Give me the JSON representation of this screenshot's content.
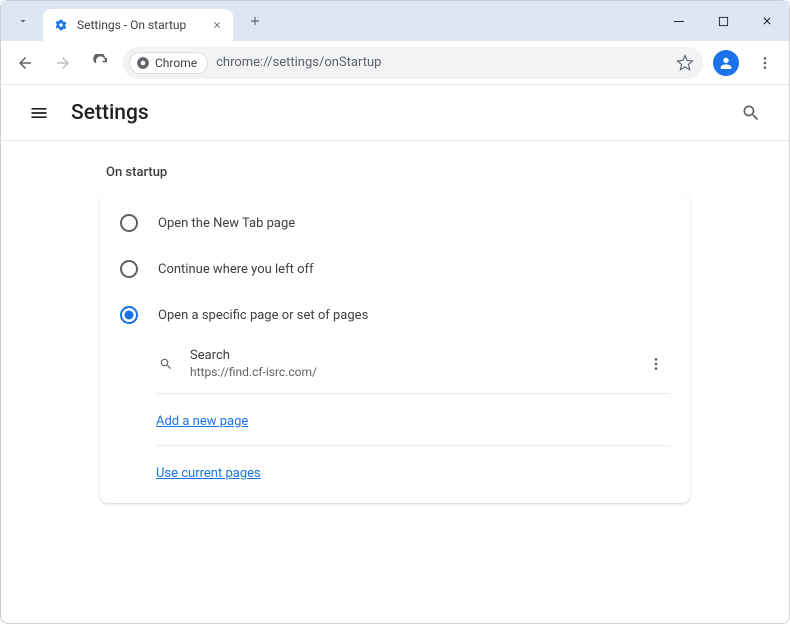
{
  "window": {
    "tab_title": "Settings - On startup"
  },
  "toolbar": {
    "chip_label": "Chrome",
    "url": "chrome://settings/onStartup"
  },
  "header": {
    "title": "Settings"
  },
  "section": {
    "title": "On startup",
    "options": [
      {
        "label": "Open the New Tab page",
        "selected": false
      },
      {
        "label": "Continue where you left off",
        "selected": false
      },
      {
        "label": "Open a specific page or set of pages",
        "selected": true
      }
    ],
    "page_entry": {
      "name": "Search",
      "url": "https://find.cf-isrc.com/"
    },
    "links": {
      "add": "Add a new page",
      "use_current": "Use current pages"
    }
  }
}
